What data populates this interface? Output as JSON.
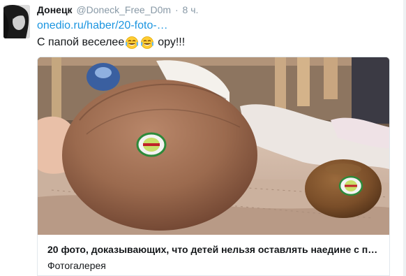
{
  "tweet": {
    "fullname": "Донецк",
    "username": "@Doneck_Free_D0m",
    "separator": "·",
    "time": "8 ч.",
    "link": "onedio.ru/haber/20-foto-…",
    "text_before": "С папой веселее",
    "text_after": "ору!!!",
    "emoji": [
      "face-with-tears-of-joy",
      "face-with-tears-of-joy"
    ]
  },
  "card": {
    "title": "20 фото, доказывающих, что детей нельзя оставлять наедине с п…",
    "subtitle": "Фотогалерея"
  },
  "colors": {
    "link": "#1b95e0",
    "muted": "#8899a6",
    "text": "#14171a",
    "border": "#e1e8ed"
  }
}
